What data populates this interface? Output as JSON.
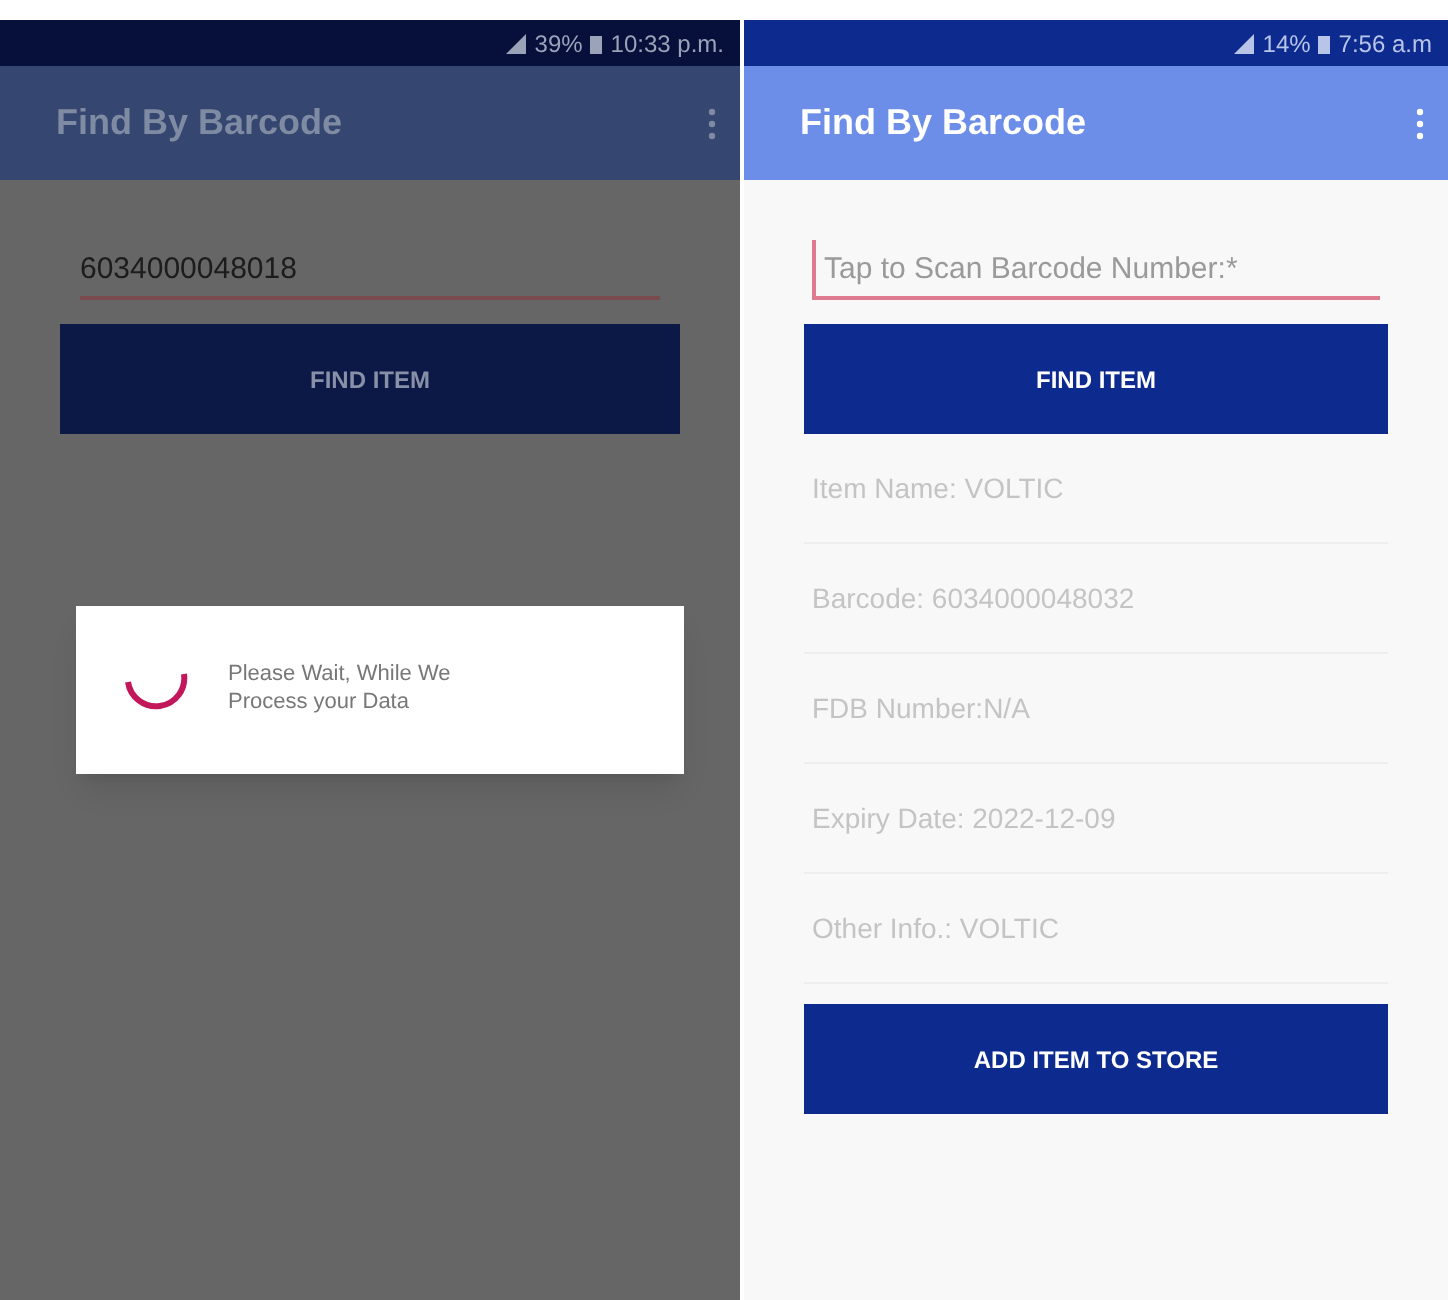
{
  "screens": [
    {
      "dimmed": true,
      "status_bar": {
        "battery": "39%",
        "time": "10:33 p.m."
      },
      "app_bar": {
        "title": "Find By Barcode"
      },
      "barcode_field": {
        "value": "6034000048018"
      },
      "find_button": "FIND ITEM",
      "dialog": {
        "message": "Please Wait, While We Process your Data"
      }
    },
    {
      "dimmed": false,
      "status_bar": {
        "battery": "14%",
        "time": "7:56 a.m"
      },
      "app_bar": {
        "title": "Find By Barcode"
      },
      "barcode_field": {
        "placeholder": "Tap to Scan Barcode Number:*"
      },
      "find_button": "FIND ITEM",
      "details": [
        "Item Name: VOLTIC",
        "Barcode: 6034000048032",
        "FDB Number:N/A",
        "Expiry Date: 2022-12-09",
        "Other Info.: VOLTIC"
      ],
      "add_button": "ADD ITEM TO STORE"
    }
  ]
}
